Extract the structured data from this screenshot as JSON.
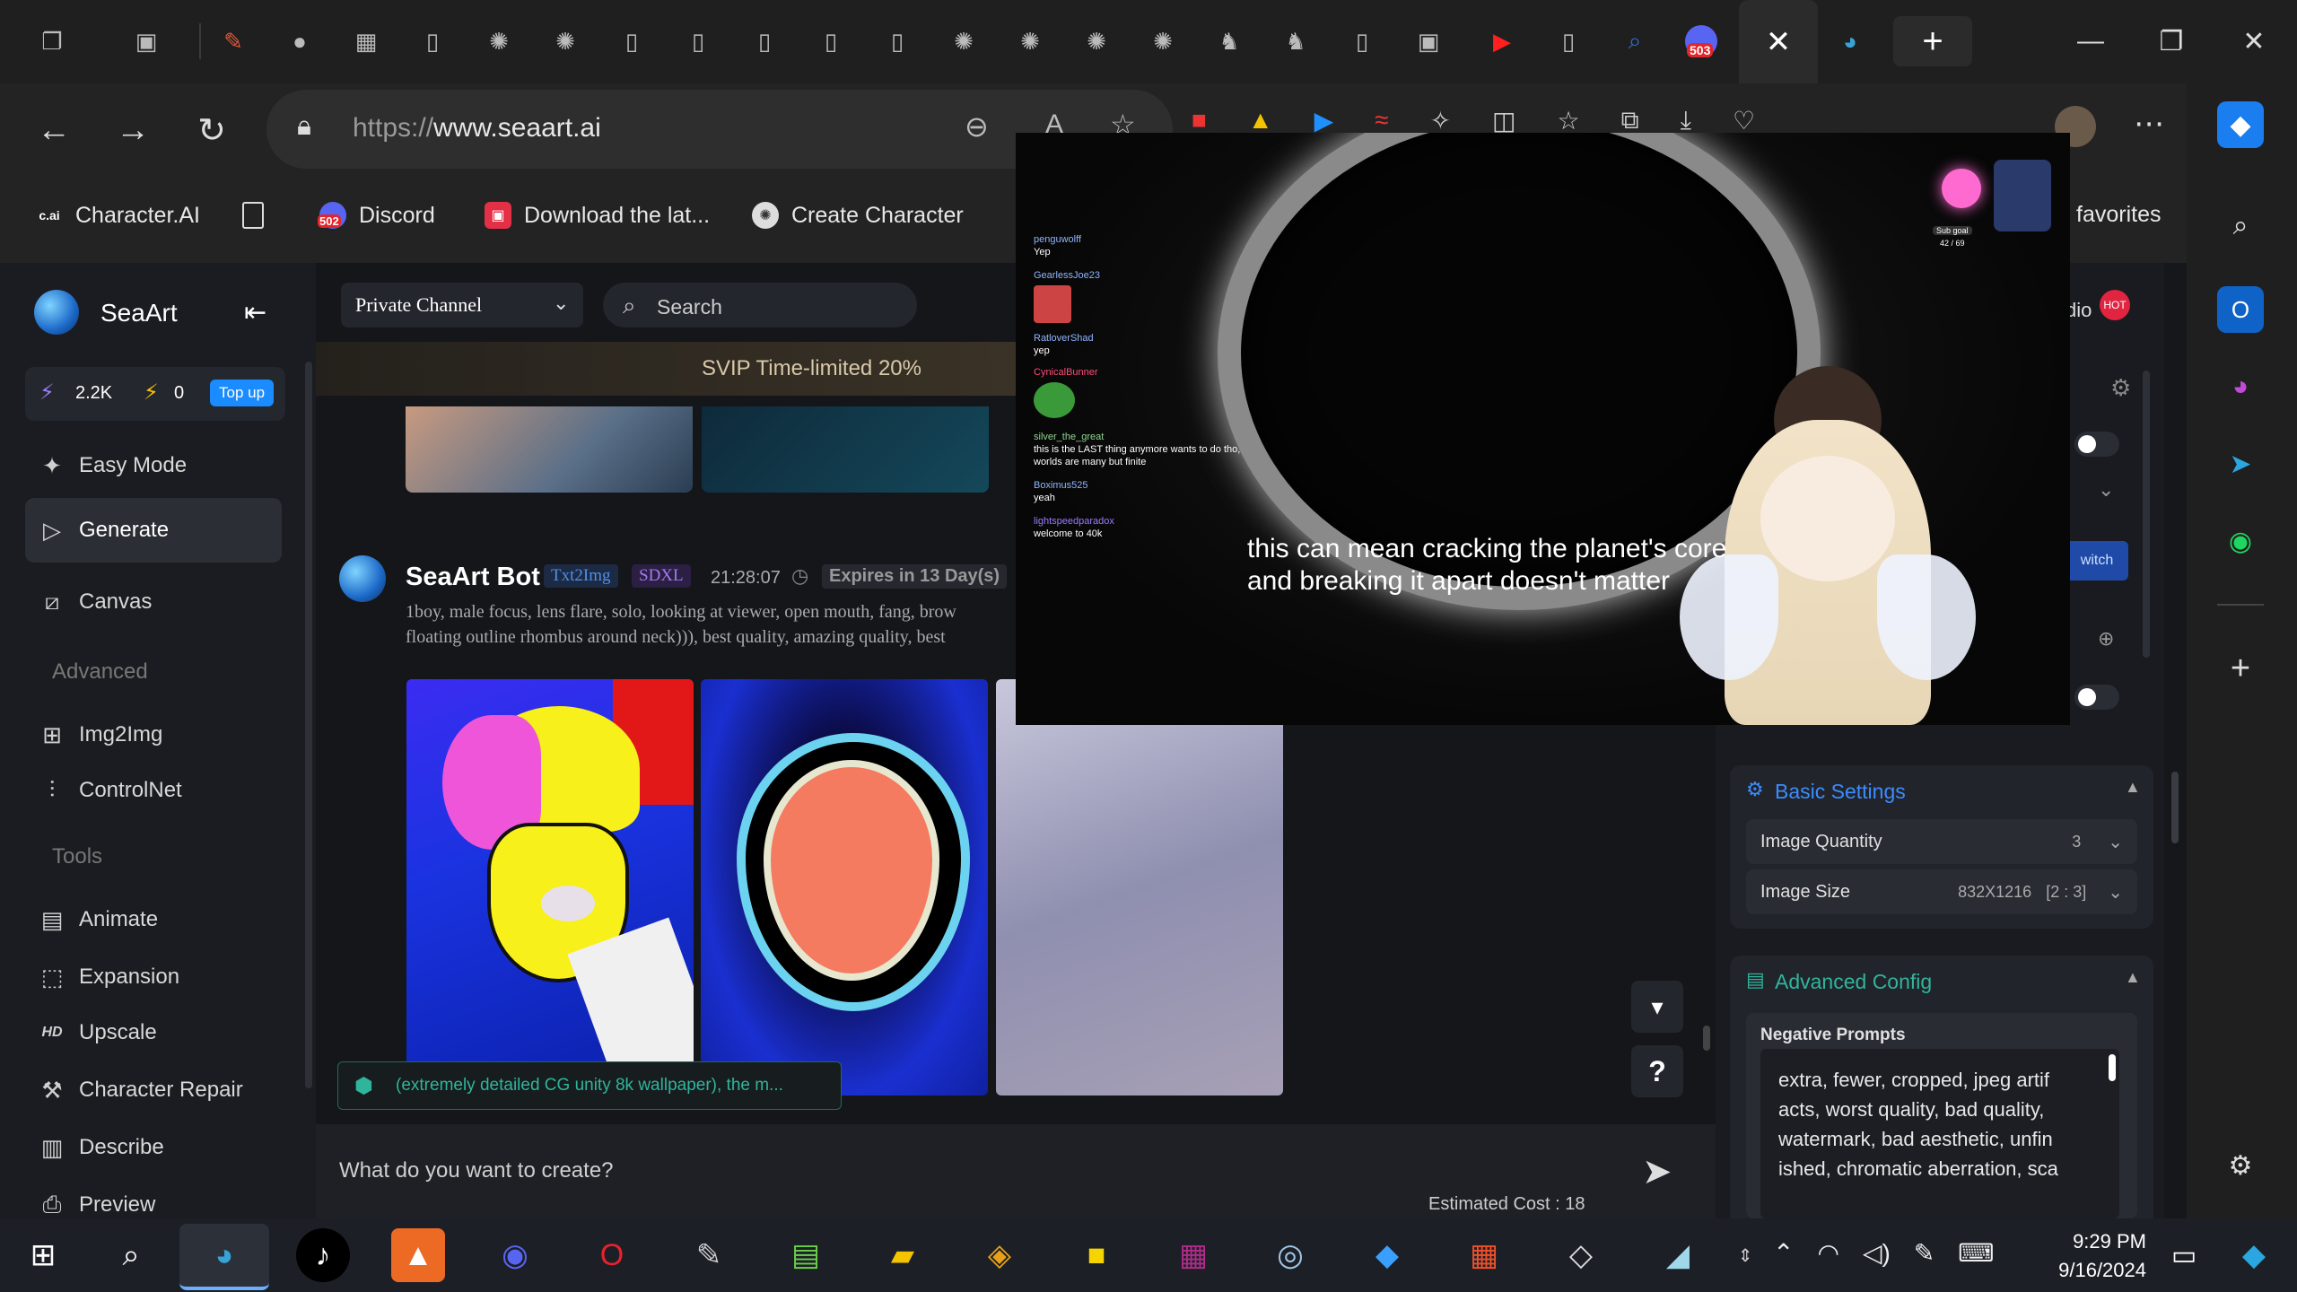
{
  "browser": {
    "url_scheme": "https://",
    "url_host": "www.seaart.ai",
    "tab_badge_503": "503",
    "new_tab": "+",
    "window_controls": [
      "minimize-icon",
      "restore-icon",
      "close-icon"
    ]
  },
  "bookmarks": [
    {
      "icon": "c.ai",
      "label": "Character.AI"
    },
    {
      "icon": "",
      "label": ""
    },
    {
      "icon": "502",
      "label": "Discord"
    },
    {
      "icon": "",
      "label": "Download the lat..."
    },
    {
      "icon": "",
      "label": "Create Character"
    },
    {
      "icon": "",
      "label": "favorites"
    }
  ],
  "sidebar": {
    "brand": "SeaArt",
    "stat1": "2.2K",
    "stat2": "0",
    "topup": "Top up",
    "items": [
      {
        "label": "Easy Mode"
      },
      {
        "label": "Generate"
      },
      {
        "label": "Canvas"
      }
    ],
    "section_advanced": "Advanced",
    "advanced_items": [
      {
        "label": "Img2Img"
      },
      {
        "label": "ControlNet"
      }
    ],
    "section_tools": "Tools",
    "tools_items": [
      {
        "label": "Animate"
      },
      {
        "label": "Expansion"
      },
      {
        "label": "Upscale"
      },
      {
        "label": "Character Repair"
      },
      {
        "label": "Describe"
      },
      {
        "label": "Preview"
      }
    ]
  },
  "main": {
    "channel": "Private Channel",
    "search_placeholder": "Search",
    "banner": "SVIP Time-limited 20%",
    "bot_name": "SeaArt Bot",
    "tag1": "Txt2Img",
    "tag2": "SDXL",
    "time": "21:28:07",
    "expires": "Expires in 13 Day(s)",
    "prompt_line1": "1boy, male focus, lens flare, solo, looking at viewer, open mouth, fang, brow",
    "prompt_line2": "floating outline rhombus around neck))), best quality, amazing quality, best",
    "chip": "(extremely detailed CG unity 8k wallpaper), the m...",
    "input_placeholder": "What do you want to create?",
    "cost": "Estimated Cost : 18",
    "help": "?"
  },
  "right": {
    "studio": "dio",
    "hot": "HOT",
    "switch": "witch",
    "basic_settings": "Basic Settings",
    "image_quantity_label": "Image Quantity",
    "image_quantity_value": "3",
    "image_size_label": "Image Size",
    "image_size_value": "832X1216",
    "image_size_ratio": "[2 : 3]",
    "advanced_config": "Advanced Config",
    "negative_prompts": "Negative Prompts",
    "neg_text": [
      "extra, fewer, cropped, jpeg artif",
      "acts, worst quality, bad quality,",
      "watermark, bad aesthetic, unfin",
      "ished, chromatic aberration, sca"
    ]
  },
  "overlay": {
    "caption_line1": "this can mean cracking the planet's core",
    "caption_line2": "and breaking it apart doesn't matter",
    "chat": [
      {
        "user": "penguwolff",
        "msg": "Yep"
      },
      {
        "user": "GearlessJoe23",
        "msg": ""
      },
      {
        "user": "RatloverShad",
        "msg": "yep"
      },
      {
        "user": "CynicalBunner",
        "msg": ""
      },
      {
        "user": "silver_the_great",
        "msg": "this is the LAST thing anymore wants to do tho, worlds are many but finite"
      },
      {
        "user": "Boximus525",
        "msg": "yeah"
      },
      {
        "user": "lightspeedparadox",
        "msg": "welcome to 40k"
      }
    ],
    "subgoal": "Sub goal",
    "subgoal_count": "42 / 69"
  },
  "taskbar": {
    "time": "9:29 PM",
    "date": "9/16/2024"
  }
}
